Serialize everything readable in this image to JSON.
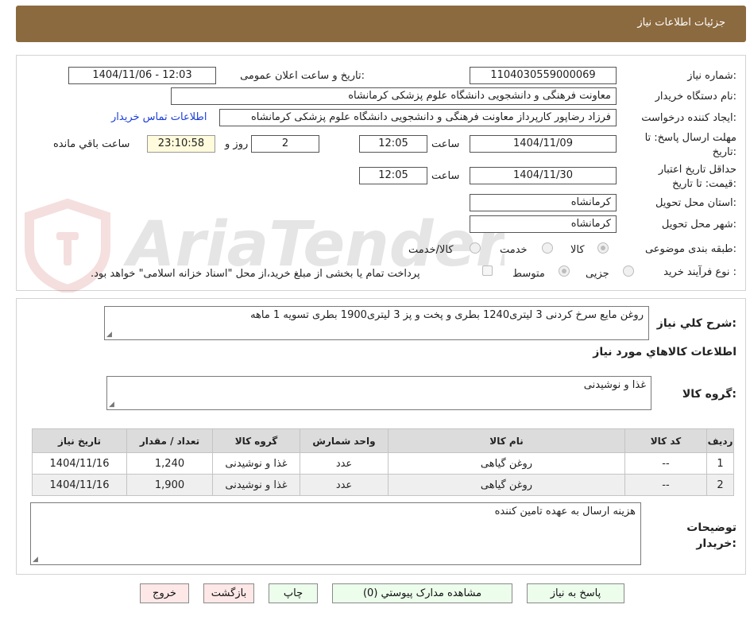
{
  "header": {
    "title": "جزئیات اطلاعات نیاز"
  },
  "form": {
    "need_number_label": "شماره نیاز:",
    "need_number": "1104030559000069",
    "announce_label": "تاریخ و ساعت اعلان عمومی:",
    "announce_value": "1404/11/06 - 12:03",
    "buyer_org_label": "نام دستگاه خریدار:",
    "buyer_org": "معاونت فرهنگی و دانشجویی دانشگاه علوم پزشکی کرمانشاه",
    "requester_label": "ایجاد کننده درخواست:",
    "requester": "فرزاد رضاپور کارپرداز معاونت فرهنگی و دانشجویی دانشگاه علوم پزشکی کرمانشاه",
    "contact_link": "اطلاعات تماس خریدار",
    "deadline_label": "مهلت ارسال پاسخ: تا تاریخ:",
    "deadline_date": "1404/11/09",
    "time_label": "ساعت",
    "deadline_time": "12:05",
    "days_count": "2",
    "days_label": "روز و",
    "remaining_time": "23:10:58",
    "remaining_label": "ساعت باقي مانده",
    "price_validity_label": "حداقل تاریخ اعتبار قیمت: تا تاریخ:",
    "price_validity_date": "1404/11/30",
    "price_validity_time": "12:05",
    "province_label": "استان محل تحویل:",
    "province": "کرمانشاه",
    "city_label": "شهر محل تحویل:",
    "city": "کرمانشاه",
    "category_label": "طبقه بندی موضوعی:",
    "category_options": [
      "کالا",
      "خدمت",
      "کالا/خدمت"
    ],
    "category_selected": "کالا",
    "process_label": "نوع فرآیند خرید :",
    "process_options": [
      "جزیی",
      "متوسط"
    ],
    "process_selected": "متوسط",
    "payment_note": "پرداخت تمام یا بخشی از مبلغ خرید،از محل \"اسناد خزانه اسلامی\" خواهد بود."
  },
  "summary": {
    "general_desc_label": "شرح کلي نياز:",
    "general_desc": "روغن مایع سرخ کردنی  3 لیتری1240 بطری و پخت و پز 3 لیتری1900 بطری تسویه 1 ماهه",
    "goods_info_title": "اطلاعات کالاهاي مورد نياز",
    "goods_group_label": "گروه کالا:",
    "goods_group": "غذا و نوشیدنی"
  },
  "table": {
    "headers": [
      "رديف",
      "کد کالا",
      "نام کالا",
      "واحد شمارش",
      "گروه کالا",
      "تعداد / مقدار",
      "تاریخ نیاز"
    ],
    "rows": [
      [
        "1",
        "--",
        "روغن گیاهی",
        "عدد",
        "غذا و نوشیدنی",
        "1,240",
        "1404/11/16"
      ],
      [
        "2",
        "--",
        "روغن گیاهی",
        "عدد",
        "غذا و نوشیدنی",
        "1,900",
        "1404/11/16"
      ]
    ]
  },
  "buyer_notes": {
    "label": "توضیحات خریدار:",
    "text": "هزینه ارسال به عهده تامین کننده"
  },
  "buttons": {
    "reply": "پاسخ به نياز",
    "attachments": "مشاهده مدارک پيوستي (0)",
    "print": "چاپ",
    "back": "بازگشت",
    "exit": "خروج"
  },
  "watermark": {
    "text": "AriaTender.neT"
  },
  "colors": {
    "header_bg": "#8c6a3f",
    "link": "#1a3ddb",
    "button_green": "#ecfdec",
    "button_red": "#fde7e7"
  }
}
